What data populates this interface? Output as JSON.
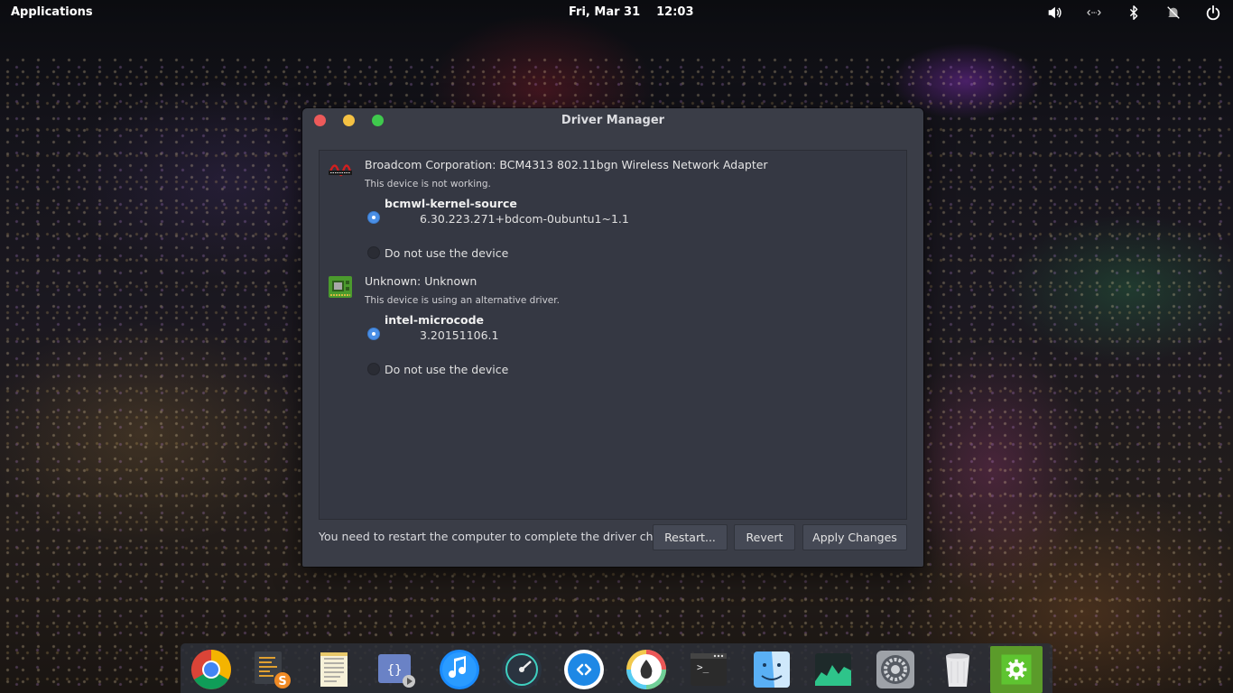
{
  "top_panel": {
    "applications_label": "Applications",
    "date": "Fri, Mar 31",
    "time": "12:03",
    "indicators": [
      "volume-icon",
      "network-icon",
      "bluetooth-icon",
      "notifications-icon",
      "power-icon"
    ]
  },
  "window": {
    "title": "Driver Manager",
    "devices": [
      {
        "name": "Broadcom Corporation: BCM4313 802.11bgn Wireless Network Adapter",
        "status": "This device is not working.",
        "icon": "broadcom-logo-icon",
        "driver": "bcmwl-kernel-source",
        "version": "6.30.223.271+bdcom-0ubuntu1~1.1",
        "selected": "driver",
        "no_device_label": "Do not use the device"
      },
      {
        "name": "Unknown: Unknown",
        "status": "This device is using an alternative driver.",
        "icon": "chip-icon",
        "driver": "intel-microcode",
        "version": "3.20151106.1",
        "selected": "driver",
        "no_device_label": "Do not use the device"
      }
    ],
    "footer_message": "You need to restart the computer to complete the driver changes.",
    "buttons": {
      "restart": "Restart...",
      "revert": "Revert",
      "apply": "Apply Changes"
    }
  },
  "dock": {
    "items": [
      "chrome-icon",
      "sublime-text-icon",
      "text-editor-icon",
      "code-editor-icon",
      "music-icon",
      "stacer-icon",
      "teamviewer-icon",
      "color-picker-icon",
      "terminal-icon",
      "finder-icon",
      "system-monitor-icon",
      "settings-icon",
      "trash-icon",
      "driver-manager-icon"
    ]
  },
  "colors": {
    "accent": "#4a8fe6",
    "close": "#ed5a5a",
    "minimize": "#f5c243",
    "maximize": "#3fc94d",
    "window_bg": "#3a3d47"
  }
}
